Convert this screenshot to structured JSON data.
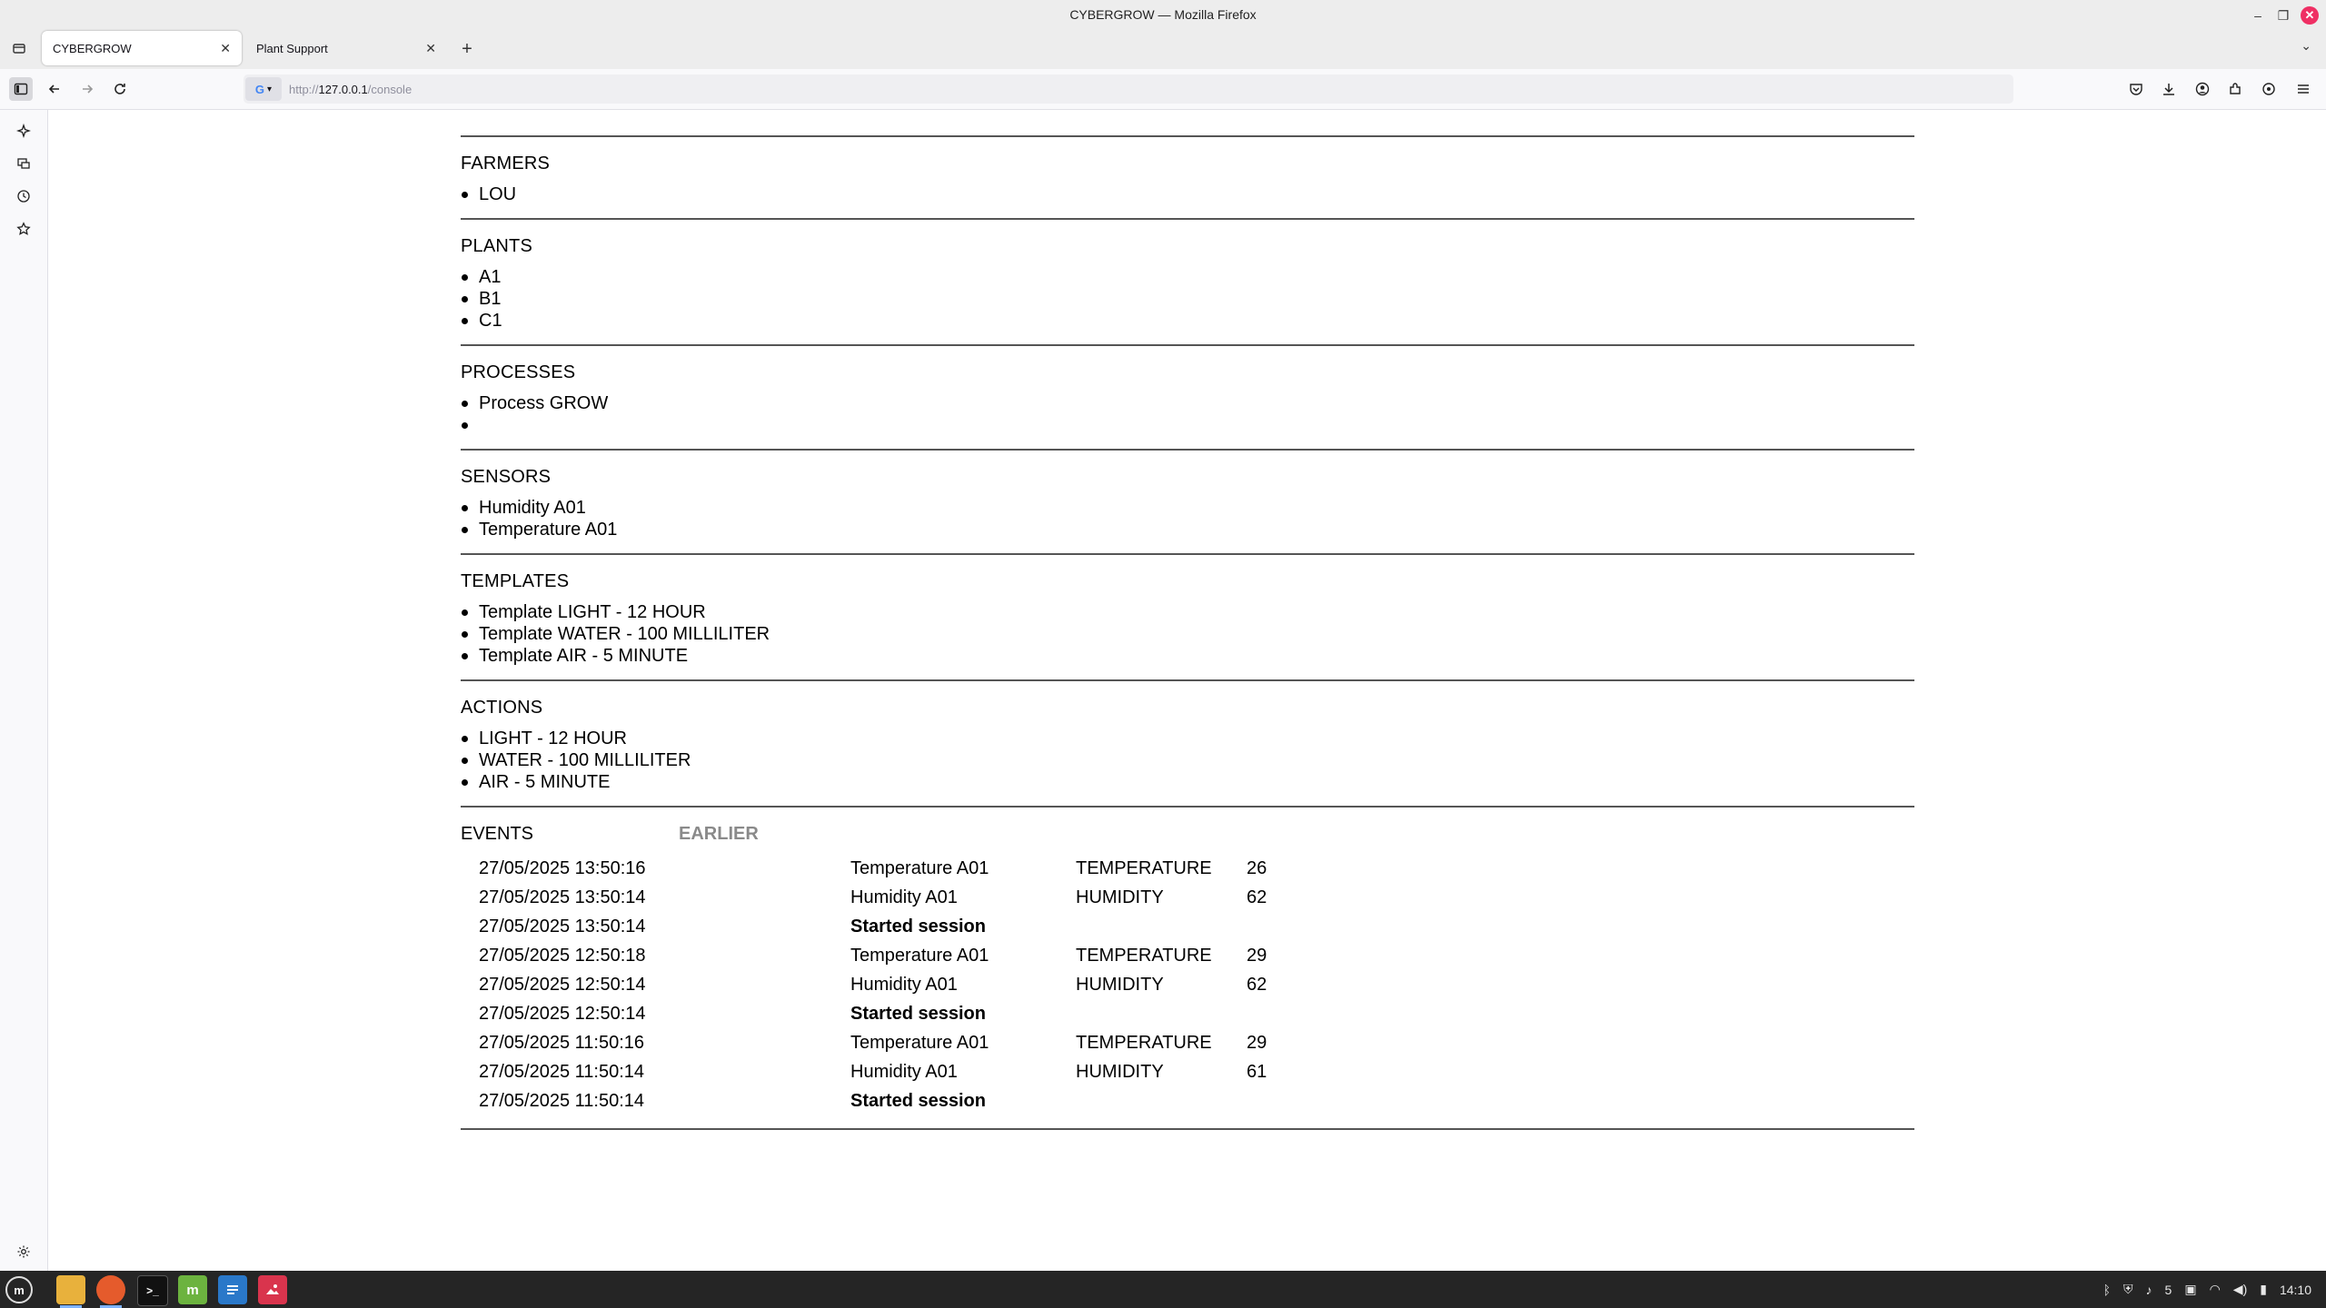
{
  "window": {
    "title": "CYBERGROW — Mozilla Firefox",
    "controls": {
      "minimize": "–",
      "restore": "❐",
      "close": "✕"
    }
  },
  "tabs": [
    {
      "label": "CYBERGROW",
      "active": true
    },
    {
      "label": "Plant Support",
      "active": false
    }
  ],
  "navbar": {
    "url_scheme": "http://",
    "url_host": "127.0.0.1",
    "url_path": "/console",
    "search_engine_icon": "G"
  },
  "sections": {
    "farmers": {
      "title": "FARMERS",
      "items": [
        "LOU"
      ]
    },
    "plants": {
      "title": "PLANTS",
      "items": [
        "A1",
        "B1",
        "C1"
      ]
    },
    "processes": {
      "title": "PROCESSES",
      "items": [
        "Process GROW",
        ""
      ]
    },
    "sensors": {
      "title": "SENSORS",
      "items": [
        "Humidity A01",
        "Temperature A01"
      ]
    },
    "templates": {
      "title": "TEMPLATES",
      "items": [
        "Template LIGHT - 12 HOUR",
        "Template WATER - 100 MILLILITER",
        "Template AIR - 5 MINUTE"
      ]
    },
    "actions": {
      "title": "ACTIONS",
      "items": [
        "LIGHT - 12 HOUR",
        "WATER - 100 MILLILITER",
        "AIR - 5 MINUTE"
      ]
    }
  },
  "events": {
    "title": "EVENTS",
    "earlier_label": "EARLIER",
    "rows": [
      {
        "time": "27/05/2025 13:50:16",
        "source": "Temperature A01",
        "metric": "TEMPERATURE",
        "value": "26",
        "session": false
      },
      {
        "time": "27/05/2025 13:50:14",
        "source": "Humidity A01",
        "metric": "HUMIDITY",
        "value": "62",
        "session": false
      },
      {
        "time": "27/05/2025 13:50:14",
        "source": "Started session",
        "metric": "",
        "value": "",
        "session": true
      },
      {
        "time": "27/05/2025 12:50:18",
        "source": "Temperature A01",
        "metric": "TEMPERATURE",
        "value": "29",
        "session": false
      },
      {
        "time": "27/05/2025 12:50:14",
        "source": "Humidity A01",
        "metric": "HUMIDITY",
        "value": "62",
        "session": false
      },
      {
        "time": "27/05/2025 12:50:14",
        "source": "Started session",
        "metric": "",
        "value": "",
        "session": true
      },
      {
        "time": "27/05/2025 11:50:16",
        "source": "Temperature A01",
        "metric": "TEMPERATURE",
        "value": "29",
        "session": false
      },
      {
        "time": "27/05/2025 11:50:14",
        "source": "Humidity A01",
        "metric": "HUMIDITY",
        "value": "61",
        "session": false
      },
      {
        "time": "27/05/2025 11:50:14",
        "source": "Started session",
        "metric": "",
        "value": "",
        "session": true
      }
    ]
  },
  "taskbar": {
    "tray_battery_count": "5",
    "clock": "14:10"
  },
  "colors": {
    "accent_close": "#ef2f64",
    "earlier_link": "#8a8a8a",
    "taskbar": "#252525"
  }
}
